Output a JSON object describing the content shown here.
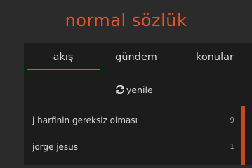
{
  "site": {
    "logo": "normal sözlük",
    "accent_color": "#e0542a"
  },
  "tabs": [
    {
      "label": "akış",
      "active": true
    },
    {
      "label": "gündem",
      "active": false
    },
    {
      "label": "konular",
      "active": false
    }
  ],
  "refresh": {
    "label": "yenile",
    "icon": "refresh-icon"
  },
  "topics": [
    {
      "title": "j harfinin gereksiz olması",
      "count": "9"
    },
    {
      "title": "jorge jesus",
      "count": "1"
    }
  ]
}
